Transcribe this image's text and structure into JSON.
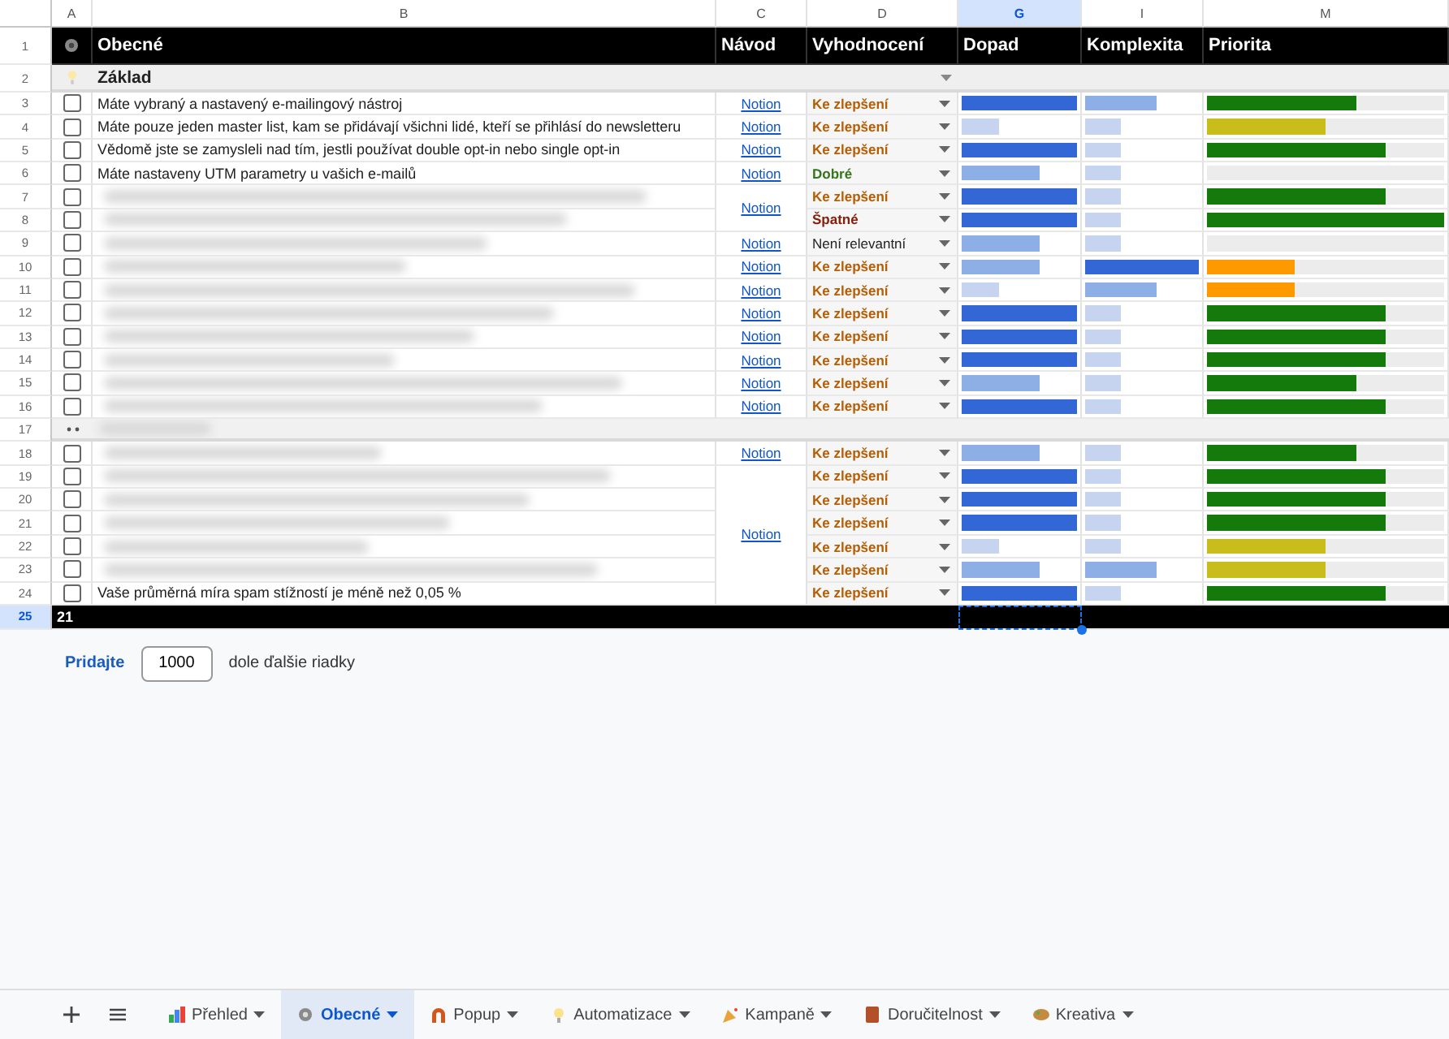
{
  "column_headers": [
    {
      "label": "A",
      "selected": false
    },
    {
      "label": "B",
      "selected": false
    },
    {
      "label": "C",
      "selected": false
    },
    {
      "label": "D",
      "selected": false
    },
    {
      "label": "G",
      "selected": true
    },
    {
      "label": "I",
      "selected": false
    },
    {
      "label": "M",
      "selected": false
    }
  ],
  "header_row": {
    "number": "1",
    "cells": [
      "Obecné",
      "Návod",
      "Vyhodnocení",
      "Dopad",
      "Komplexita",
      "Priorita"
    ]
  },
  "section": {
    "number": "2",
    "title": "Základ"
  },
  "rows": [
    {
      "number": "3",
      "kind": "item",
      "checked": false,
      "text": "Máte vybraný a nastavený e-mailingový nástroj",
      "guide": "Notion",
      "status": {
        "label": "Ke zlepšení",
        "color": "#b45f06"
      },
      "impact": {
        "level": 1,
        "color": "#3367d6"
      },
      "complexity": {
        "level": 0.63,
        "color": "#8eaee6"
      },
      "priority": {
        "level": 0.63,
        "color": "#137a0b"
      }
    },
    {
      "number": "4",
      "kind": "item",
      "checked": false,
      "text": "Máte pouze jeden master list, kam se přidávají všichni lidé, kteří se přihlásí do newsletteru",
      "guide": "Notion",
      "status": {
        "label": "Ke zlepšení",
        "color": "#b45f06"
      },
      "impact": {
        "level": 0.33,
        "color": "#c6d4ef"
      },
      "complexity": {
        "level": 0.31,
        "color": "#c6d4ef"
      },
      "priority": {
        "level": 0.5,
        "color": "#c9bd1c"
      }
    },
    {
      "number": "5",
      "kind": "item",
      "checked": false,
      "text": "Vědomě jste se zamysleli nad tím, jestli používat double opt-in nebo single opt-in",
      "guide": "Notion",
      "status": {
        "label": "Ke zlepšení",
        "color": "#b45f06"
      },
      "impact": {
        "level": 1,
        "color": "#3367d6"
      },
      "complexity": {
        "level": 0.31,
        "color": "#c6d4ef"
      },
      "priority": {
        "level": 0.75,
        "color": "#137a0b"
      }
    },
    {
      "number": "6",
      "kind": "item",
      "checked": false,
      "text": "Máte nastaveny UTM parametry u vašich e-mailů",
      "guide": "Notion",
      "status": {
        "label": "Dobré",
        "color": "#38761d"
      },
      "impact": {
        "level": 0.67,
        "color": "#8eaee6"
      },
      "complexity": {
        "level": 0.31,
        "color": "#c6d4ef"
      }
    },
    {
      "number": "7",
      "kind": "item",
      "checked": false,
      "guide": "Notion",
      "status": {
        "label": "Ke zlepšení",
        "color": "#b45f06"
      },
      "impact": {
        "level": 1,
        "color": "#3367d6"
      },
      "complexity": {
        "level": 0.31,
        "color": "#c6d4ef"
      },
      "priority": {
        "level": 0.75,
        "color": "#137a0b"
      }
    },
    {
      "number": "8",
      "kind": "item",
      "checked": false,
      "status": {
        "label": "Špatné",
        "color": "#85200c"
      },
      "impact": {
        "level": 1,
        "color": "#3367d6"
      },
      "complexity": {
        "level": 0.31,
        "color": "#c6d4ef"
      },
      "priority": {
        "level": 1,
        "color": "#137a0b"
      }
    },
    {
      "number": "9",
      "kind": "item",
      "checked": false,
      "guide": "Notion",
      "status": {
        "label": "Není relevantní",
        "color": "#222222"
      },
      "impact": {
        "level": 0.67,
        "color": "#8eaee6"
      },
      "complexity": {
        "level": 0.31,
        "color": "#c6d4ef"
      }
    },
    {
      "number": "10",
      "kind": "item",
      "checked": false,
      "guide": "Notion",
      "status": {
        "label": "Ke zlepšení",
        "color": "#b45f06"
      },
      "impact": {
        "level": 0.67,
        "color": "#8eaee6"
      },
      "complexity": {
        "level": 1,
        "color": "#3367d6"
      },
      "priority": {
        "level": 0.37,
        "color": "#ff9900"
      }
    },
    {
      "number": "11",
      "kind": "item",
      "checked": false,
      "guide": "Notion",
      "status": {
        "label": "Ke zlepšení",
        "color": "#b45f06"
      },
      "impact": {
        "level": 0.33,
        "color": "#c6d4ef"
      },
      "complexity": {
        "level": 0.63,
        "color": "#8eaee6"
      },
      "priority": {
        "level": 0.37,
        "color": "#ff9900"
      }
    },
    {
      "number": "12",
      "kind": "item",
      "checked": false,
      "guide": "Notion",
      "status": {
        "label": "Ke zlepšení",
        "color": "#b45f06"
      },
      "impact": {
        "level": 1,
        "color": "#3367d6"
      },
      "complexity": {
        "level": 0.31,
        "color": "#c6d4ef"
      },
      "priority": {
        "level": 0.75,
        "color": "#137a0b"
      }
    },
    {
      "number": "13",
      "kind": "item",
      "checked": false,
      "guide": "Notion",
      "status": {
        "label": "Ke zlepšení",
        "color": "#b45f06"
      },
      "impact": {
        "level": 1,
        "color": "#3367d6"
      },
      "complexity": {
        "level": 0.31,
        "color": "#c6d4ef"
      },
      "priority": {
        "level": 0.75,
        "color": "#137a0b"
      }
    },
    {
      "number": "14",
      "kind": "item",
      "checked": false,
      "guide": "Notion",
      "status": {
        "label": "Ke zlepšení",
        "color": "#b45f06"
      },
      "impact": {
        "level": 1,
        "color": "#3367d6"
      },
      "complexity": {
        "level": 0.31,
        "color": "#c6d4ef"
      },
      "priority": {
        "level": 0.75,
        "color": "#137a0b"
      }
    },
    {
      "number": "15",
      "kind": "item",
      "checked": false,
      "guide": "Notion",
      "status": {
        "label": "Ke zlepšení",
        "color": "#b45f06"
      },
      "impact": {
        "level": 0.67,
        "color": "#8eaee6"
      },
      "complexity": {
        "level": 0.31,
        "color": "#c6d4ef"
      },
      "priority": {
        "level": 0.63,
        "color": "#137a0b"
      }
    },
    {
      "number": "16",
      "kind": "item",
      "checked": false,
      "guide": "Notion",
      "status": {
        "label": "Ke zlepšení",
        "color": "#b45f06"
      },
      "impact": {
        "level": 1,
        "color": "#3367d6"
      },
      "complexity": {
        "level": 0.31,
        "color": "#c6d4ef"
      },
      "priority": {
        "level": 0.75,
        "color": "#137a0b"
      }
    },
    {
      "number": "17",
      "kind": "group"
    },
    {
      "number": "18",
      "kind": "item",
      "checked": false,
      "guide": "Notion",
      "status": {
        "label": "Ke zlepšení",
        "color": "#b45f06"
      },
      "impact": {
        "level": 0.67,
        "color": "#8eaee6"
      },
      "complexity": {
        "level": 0.31,
        "color": "#c6d4ef"
      },
      "priority": {
        "level": 0.63,
        "color": "#137a0b"
      }
    },
    {
      "number": "19",
      "kind": "item",
      "checked": false,
      "guide": "Notion",
      "status": {
        "label": "Ke zlepšení",
        "color": "#b45f06"
      },
      "impact": {
        "level": 1,
        "color": "#3367d6"
      },
      "complexity": {
        "level": 0.31,
        "color": "#c6d4ef"
      },
      "priority": {
        "level": 0.75,
        "color": "#137a0b"
      }
    },
    {
      "number": "20",
      "kind": "item",
      "checked": false,
      "status": {
        "label": "Ke zlepšení",
        "color": "#b45f06"
      },
      "impact": {
        "level": 1,
        "color": "#3367d6"
      },
      "complexity": {
        "level": 0.31,
        "color": "#c6d4ef"
      },
      "priority": {
        "level": 0.75,
        "color": "#137a0b"
      }
    },
    {
      "number": "21",
      "kind": "item",
      "checked": false,
      "status": {
        "label": "Ke zlepšení",
        "color": "#b45f06"
      },
      "impact": {
        "level": 1,
        "color": "#3367d6"
      },
      "complexity": {
        "level": 0.31,
        "color": "#c6d4ef"
      },
      "priority": {
        "level": 0.75,
        "color": "#137a0b"
      }
    },
    {
      "number": "22",
      "kind": "item",
      "checked": false,
      "status": {
        "label": "Ke zlepšení",
        "color": "#b45f06"
      },
      "impact": {
        "level": 0.33,
        "color": "#c6d4ef"
      },
      "complexity": {
        "level": 0.31,
        "color": "#c6d4ef"
      },
      "priority": {
        "level": 0.5,
        "color": "#c9bd1c"
      }
    },
    {
      "number": "23",
      "kind": "item",
      "checked": false,
      "status": {
        "label": "Ke zlepšení",
        "color": "#b45f06"
      },
      "impact": {
        "level": 0.67,
        "color": "#8eaee6"
      },
      "complexity": {
        "level": 0.63,
        "color": "#8eaee6"
      },
      "priority": {
        "level": 0.5,
        "color": "#c9bd1c"
      }
    },
    {
      "number": "24",
      "kind": "item",
      "checked": false,
      "text": "Vaše průměrná míra spam stížností je méně než 0,05 %",
      "status": {
        "label": "Ke zlepšení",
        "color": "#b45f06"
      },
      "impact": {
        "level": 1,
        "color": "#3367d6"
      },
      "complexity": {
        "level": 0.31,
        "color": "#c6d4ef"
      },
      "priority": {
        "level": 0.75,
        "color": "#137a0b"
      }
    }
  ],
  "total_row": {
    "number": "25",
    "selected": true,
    "count": "21"
  },
  "add_rows": {
    "button": "Pridajte",
    "value": "1000",
    "suffix": "dole ďalšie riadky"
  },
  "sheet_tabs": [
    {
      "label": "Přehled",
      "selected": false
    },
    {
      "label": "Obecné",
      "selected": true
    },
    {
      "label": "Popup",
      "selected": false
    },
    {
      "label": "Automatizace",
      "selected": false
    },
    {
      "label": "Kampaně",
      "selected": false
    },
    {
      "label": "Doručitelnost",
      "selected": false
    },
    {
      "label": "Kreativa",
      "selected": false
    }
  ]
}
